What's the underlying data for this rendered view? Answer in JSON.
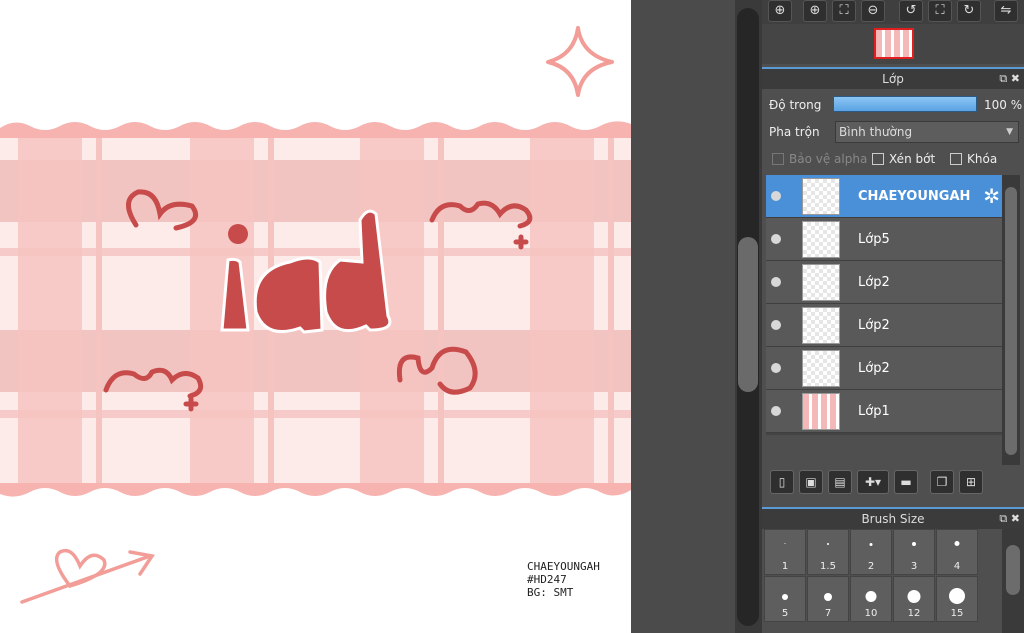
{
  "canvas": {
    "artwork_letters": "id",
    "caption_lines": [
      "CHAEYOUNGAH",
      "#HD247",
      "BG: SMT"
    ],
    "accent_color": "#c84b4b",
    "stripe_color": "#f0a6a6"
  },
  "navigator": {
    "tools": [
      "zoom-to-fit-icon",
      "zoom-in-icon",
      "fit-screen-icon",
      "zoom-out-icon",
      "rotate-left-icon",
      "reset-icon",
      "rotate-right-icon",
      "flip-icon"
    ]
  },
  "layers_panel": {
    "title": "Lớp",
    "opacity_label": "Độ trong",
    "opacity_value": "100 %",
    "opacity_fraction": 1.0,
    "blend_label": "Pha trộn",
    "blend_value": "Bình thường",
    "protect_alpha_label": "Bảo vệ alpha",
    "clipping_label": "Xén bớt",
    "lock_label": "Khóa",
    "layers": [
      {
        "name": "CHAEYOUNGAH",
        "active": true
      },
      {
        "name": "Lớp5",
        "active": false
      },
      {
        "name": "Lớp2",
        "active": false
      },
      {
        "name": "Lớp2",
        "active": false
      },
      {
        "name": "Lớp2",
        "active": false
      },
      {
        "name": "Lớp1",
        "active": false
      }
    ]
  },
  "brush_panel": {
    "title": "Brush Size",
    "sizes": [
      "1",
      "1.5",
      "2",
      "3",
      "4",
      "5",
      "7",
      "10",
      "12",
      "15"
    ]
  },
  "colors": {
    "active_layer": "#4a90d9",
    "panel_bg": "#4f4f4f",
    "opacity_bar": "#6fb4ee"
  }
}
